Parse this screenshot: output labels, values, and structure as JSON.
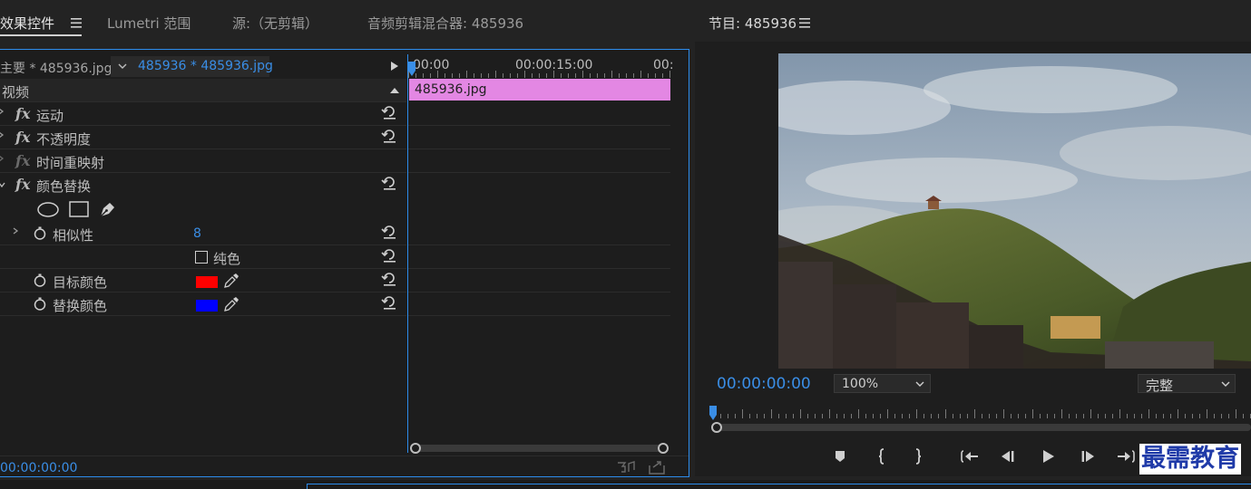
{
  "effects_panel": {
    "tabs": [
      {
        "label": "效果控件"
      },
      {
        "label": "Lumetri 范围"
      },
      {
        "label": "源:（无剪辑）"
      },
      {
        "label": "音频剪辑混合器: 485936"
      }
    ],
    "menu_icon": "hamburger-icon",
    "clip_selector": {
      "master": "主要 * 485936.jpg",
      "clip": "485936 * 485936.jpg"
    },
    "section_video": "视频",
    "effects": [
      {
        "name": "运动"
      },
      {
        "name": "不透明度"
      },
      {
        "name": "时间重映射"
      },
      {
        "name": "颜色替换"
      }
    ],
    "params": {
      "similarity": {
        "label": "相似性",
        "value": "8"
      },
      "solid": {
        "label": "纯色"
      },
      "target_color": {
        "label": "目标颜色",
        "color": "#ff0000"
      },
      "replace_color": {
        "label": "替换颜色",
        "color": "#0000ff"
      }
    },
    "timeline": {
      "ruler": [
        "00:00",
        "00:00:15:00",
        "00:"
      ],
      "clip_label": "485936.jpg",
      "clip_color": "#e387e3"
    },
    "timecode": "00:00:00:00"
  },
  "program_monitor": {
    "title": "节目: 485936",
    "timecode": "00:00:00:00",
    "zoom": "100%",
    "quality": "完整",
    "controls": [
      "marker-icon",
      "mark-in-icon",
      "mark-out-icon",
      "go-to-in-icon",
      "step-back-icon",
      "play-icon",
      "step-forward-icon",
      "go-to-out-icon"
    ]
  },
  "watermark": "最需教育",
  "colors": {
    "accent": "#2d8ceb",
    "timecode": "#3a8ee6",
    "background": "#1e1e1e"
  }
}
